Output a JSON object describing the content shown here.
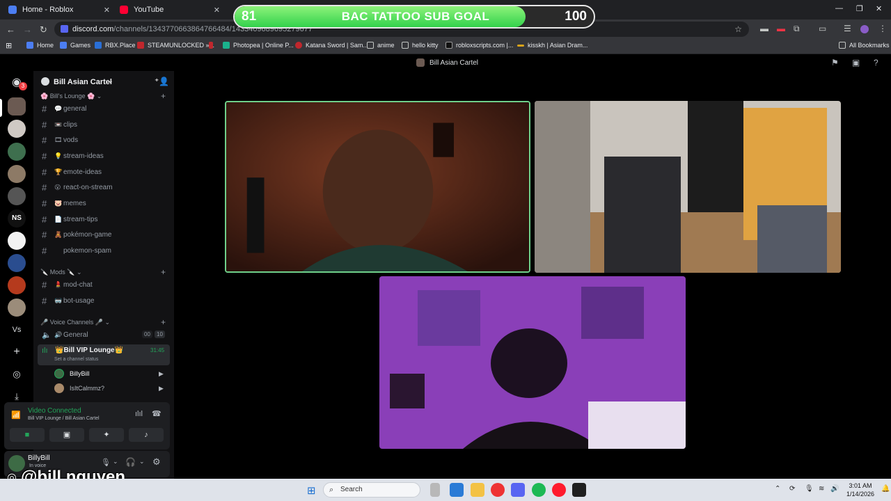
{
  "browser": {
    "tabs": [
      {
        "label": "Home - Roblox"
      },
      {
        "label": "YouTube"
      }
    ],
    "url_host": "discord.com",
    "url_path": "/channels/1343770663864766484/1433409689695279677",
    "bookmarks": [
      "Home",
      "Games",
      "RBX.Place",
      "STEAMUNLOCKED »...",
      "Photopea | Online P...",
      "Katana Sword | Sam...",
      "anime",
      "hello kitty",
      "robloxscripts.com |...",
      "kisskh | Asian Dram..."
    ],
    "all_bookmarks": "All Bookmarks"
  },
  "discord": {
    "window_title": "Bill Asian Cartel",
    "mention_badge": "3",
    "server_name": "Bill Asian Cartel",
    "categories": {
      "lounge": "Bill's Lounge",
      "mods": "Mods",
      "voice": "Voice Channels"
    },
    "text_channels": [
      {
        "emoji": "💬",
        "name": "general"
      },
      {
        "emoji": "📼",
        "name": "clips"
      },
      {
        "emoji": "🎞",
        "name": "vods"
      },
      {
        "emoji": "💡",
        "name": "stream-ideas"
      },
      {
        "emoji": "🏆",
        "name": "emote-ideas"
      },
      {
        "emoji": "😮",
        "name": "react-on-stream"
      },
      {
        "emoji": "🐷",
        "name": "memes"
      },
      {
        "emoji": "📄",
        "name": "stream-tips"
      },
      {
        "emoji": "🧸",
        "name": "pokémon-game"
      },
      {
        "emoji": "",
        "name": "pokemon-spam"
      }
    ],
    "mod_channels": [
      {
        "emoji": "💄",
        "name": "mod-chat"
      },
      {
        "emoji": "🥽",
        "name": "bot-usage"
      }
    ],
    "voice_general": {
      "name": "General",
      "count_a": "00",
      "count_b": "10"
    },
    "vip_channel": {
      "name": "Bill VIP Lounge",
      "timer": "31:45",
      "status": "Set a channel status"
    },
    "members": [
      "BillyBill",
      "IsItCalmmz?"
    ],
    "voice_panel": {
      "status": "Video Connected",
      "location": "Bill VIP Lounge / Bill Asian Cartel"
    },
    "user": {
      "name": "BillyBill",
      "status": "In voice"
    }
  },
  "overlay": {
    "goal_title": "BAC TATTOO SUB GOAL",
    "goal_current": "81",
    "goal_target": "100",
    "goal_progress": 0.81,
    "handle": "@bill.nguyen"
  },
  "taskbar": {
    "search_placeholder": "Search",
    "time": "3:01 AM",
    "date": "1/14/2026"
  },
  "colors": {
    "discord_green": "#23a55a",
    "goal_green": "#33d24c",
    "voice_connected": "#23a55a"
  }
}
